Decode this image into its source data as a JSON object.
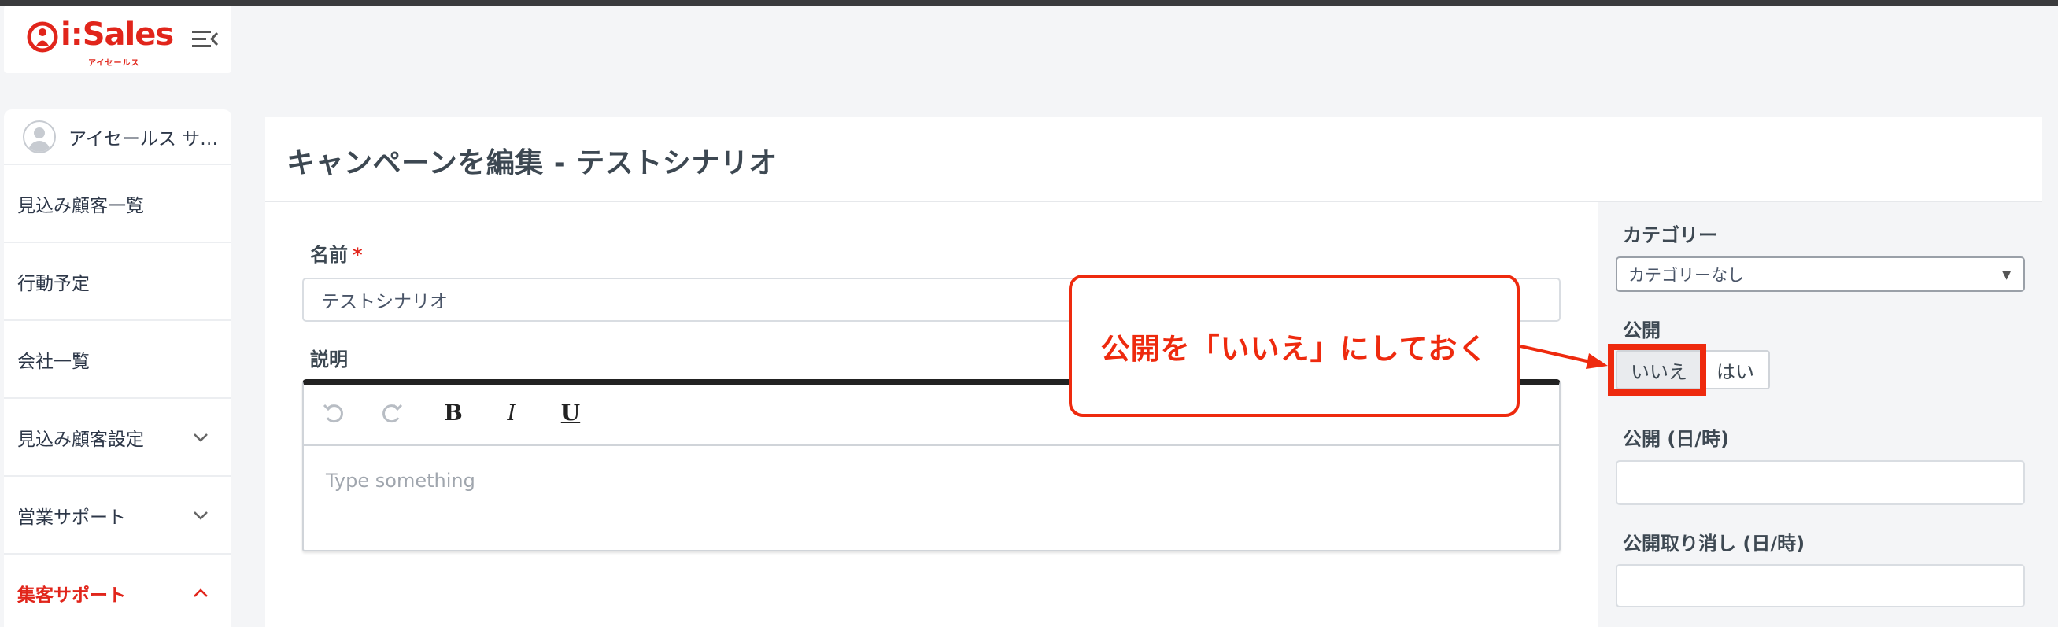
{
  "brand": {
    "name": "i:Sales",
    "subtitle": "アイセールス",
    "color": "#e1251b"
  },
  "sidebar": {
    "user_name": "アイセールス サポート",
    "items": [
      {
        "label": "見込み顧客一覧",
        "has_chevron": false,
        "active": false
      },
      {
        "label": "行動予定",
        "has_chevron": false,
        "active": false
      },
      {
        "label": "会社一覧",
        "has_chevron": false,
        "active": false
      },
      {
        "label": "見込み顧客設定",
        "has_chevron": true,
        "chevron": "down",
        "active": false
      },
      {
        "label": "営業サポート",
        "has_chevron": true,
        "chevron": "down",
        "active": false
      },
      {
        "label": "集客サポート",
        "has_chevron": true,
        "chevron": "up",
        "active": true
      }
    ]
  },
  "page": {
    "title": "キャンペーンを編集 - テストシナリオ"
  },
  "form": {
    "name_label": "名前",
    "required_mark": "*",
    "name_value": "テストシナリオ",
    "description_label": "説明",
    "description_placeholder": "Type something",
    "toolbar": [
      "undo-icon",
      "redo-icon",
      "bold-icon",
      "italic-icon",
      "underline-icon"
    ],
    "toolbar_glyphs": {
      "bold": "B",
      "italic": "I",
      "underline": "U"
    }
  },
  "side_panel": {
    "category_label": "カテゴリー",
    "category_value": "カテゴリーなし",
    "publish_label": "公開",
    "publish_no": "いいえ",
    "publish_yes": "はい",
    "publish_selected": "いいえ",
    "publish_datetime_label": "公開 (日/時)",
    "unpublish_datetime_label": "公開取り消し (日/時)"
  },
  "annotation": {
    "text": "公開を「いいえ」にしておく",
    "color": "#ee2a0e"
  }
}
